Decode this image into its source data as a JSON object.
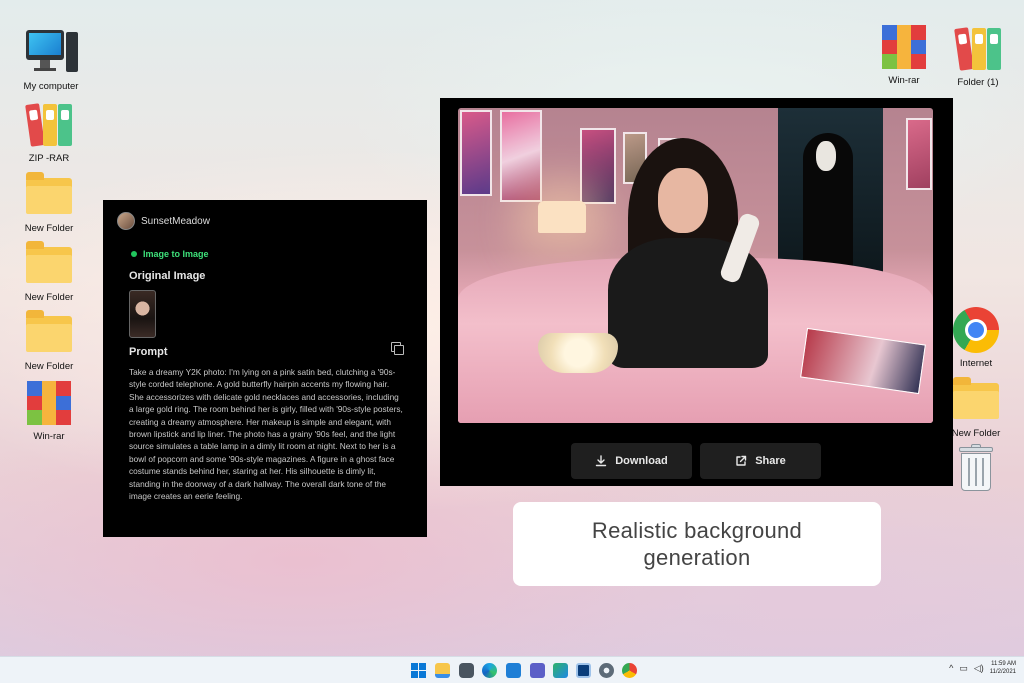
{
  "desktop": {
    "icons_left": [
      {
        "label": "My computer",
        "icon": "computer-icon"
      },
      {
        "label": "ZIP -RAR",
        "icon": "binder-icon"
      },
      {
        "label": "New Folder",
        "icon": "folder-icon"
      },
      {
        "label": "New Folder",
        "icon": "folder-icon"
      },
      {
        "label": "New Folder",
        "icon": "folder-icon"
      },
      {
        "label": "Win-rar",
        "icon": "winrar-icon"
      }
    ],
    "icons_right": [
      {
        "label": "Win-rar",
        "icon": "winrar-icon"
      },
      {
        "label": "Folder (1)",
        "icon": "binder-icon"
      },
      {
        "label": "Internet",
        "icon": "chrome-icon"
      },
      {
        "label": "New Folder",
        "icon": "folder-icon"
      },
      {
        "label": "",
        "icon": "recycle-bin-icon"
      }
    ]
  },
  "prompt_panel": {
    "username": "SunsetMeadow",
    "mode": "Image to Image",
    "original_title": "Original Image",
    "prompt_title": "Prompt",
    "prompt_text": "Take a dreamy Y2K photo: I'm lying on a pink satin bed, clutching a '90s-style corded telephone. A gold butterfly hairpin accents my flowing hair. She accessorizes with delicate gold necklaces and accessories, including a large gold ring. The room behind her is girly, filled with '90s-style posters, creating a dreamy atmosphere. Her makeup is simple and elegant, with brown lipstick and lip liner. The photo has a grainy '90s feel, and the light source simulates a table lamp in a dimly lit room at night. Next to her is a bowl of popcorn and some '90s-style magazines. A figure in a ghost face costume stands behind her, staring at her. His silhouette is dimly lit, standing in the doorway of a dark hallway. The overall dark tone of the image creates an eerie feeling."
  },
  "image_panel": {
    "download_label": "Download",
    "share_label": "Share"
  },
  "caption": {
    "text": "Realistic background generation"
  },
  "taskbar": {
    "time": "11:59 AM",
    "date": "11/2/2021",
    "accent": "#0a5cc2"
  }
}
